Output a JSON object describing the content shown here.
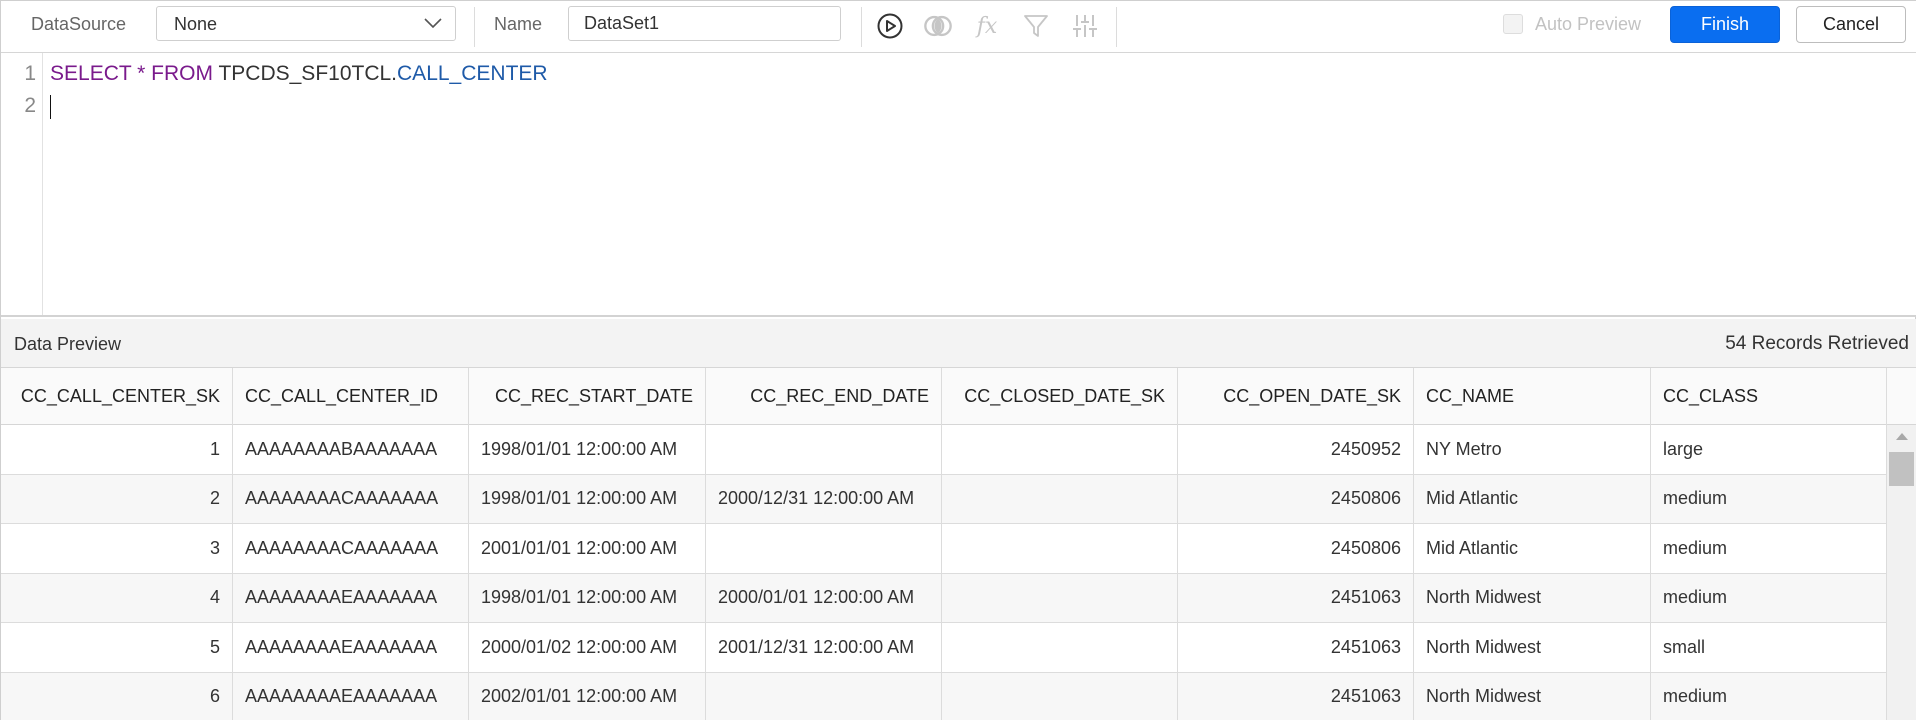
{
  "toolbar": {
    "datasource_label": "DataSource",
    "datasource_value": "None",
    "name_label": "Name",
    "name_value": "DataSet1",
    "icons": [
      "run-icon",
      "join-icon",
      "expression-icon",
      "filter-icon",
      "parameters-icon"
    ],
    "auto_preview_label": "Auto Preview",
    "auto_preview_checked": false,
    "finish_label": "Finish",
    "cancel_label": "Cancel",
    "accent_color": "#0a6ef0"
  },
  "editor": {
    "line_numbers": [
      "1",
      "2"
    ],
    "query": {
      "select": "SELECT",
      "star": " * ",
      "from": "FROM",
      "schema": " TPCDS_SF10TCL.",
      "table": "CALL_CENTER"
    }
  },
  "preview": {
    "title": "Data Preview",
    "records": "54 Records Retrieved"
  },
  "grid": {
    "columns": [
      "CC_CALL_CENTER_SK",
      "CC_CALL_CENTER_ID",
      "CC_REC_START_DATE",
      "CC_REC_END_DATE",
      "CC_CLOSED_DATE_SK",
      "CC_OPEN_DATE_SK",
      "CC_NAME",
      "CC_CLASS"
    ],
    "rows": [
      [
        "1",
        "AAAAAAAABAAAAAAA",
        "1998/01/01 12:00:00 AM",
        "",
        "",
        "2450952",
        "NY Metro",
        "large"
      ],
      [
        "2",
        "AAAAAAAACAAAAAAA",
        "1998/01/01 12:00:00 AM",
        "2000/12/31 12:00:00 AM",
        "",
        "2450806",
        "Mid Atlantic",
        "medium"
      ],
      [
        "3",
        "AAAAAAAACAAAAAAA",
        "2001/01/01 12:00:00 AM",
        "",
        "",
        "2450806",
        "Mid Atlantic",
        "medium"
      ],
      [
        "4",
        "AAAAAAAAEAAAAAAA",
        "1998/01/01 12:00:00 AM",
        "2000/01/01 12:00:00 AM",
        "",
        "2451063",
        "North Midwest",
        "medium"
      ],
      [
        "5",
        "AAAAAAAAEAAAAAAA",
        "2000/01/02 12:00:00 AM",
        "2001/12/31 12:00:00 AM",
        "",
        "2451063",
        "North Midwest",
        "small"
      ],
      [
        "6",
        "AAAAAAAAEAAAAAAA",
        "2002/01/01 12:00:00 AM",
        "",
        "",
        "2451063",
        "North Midwest",
        "medium"
      ]
    ]
  }
}
